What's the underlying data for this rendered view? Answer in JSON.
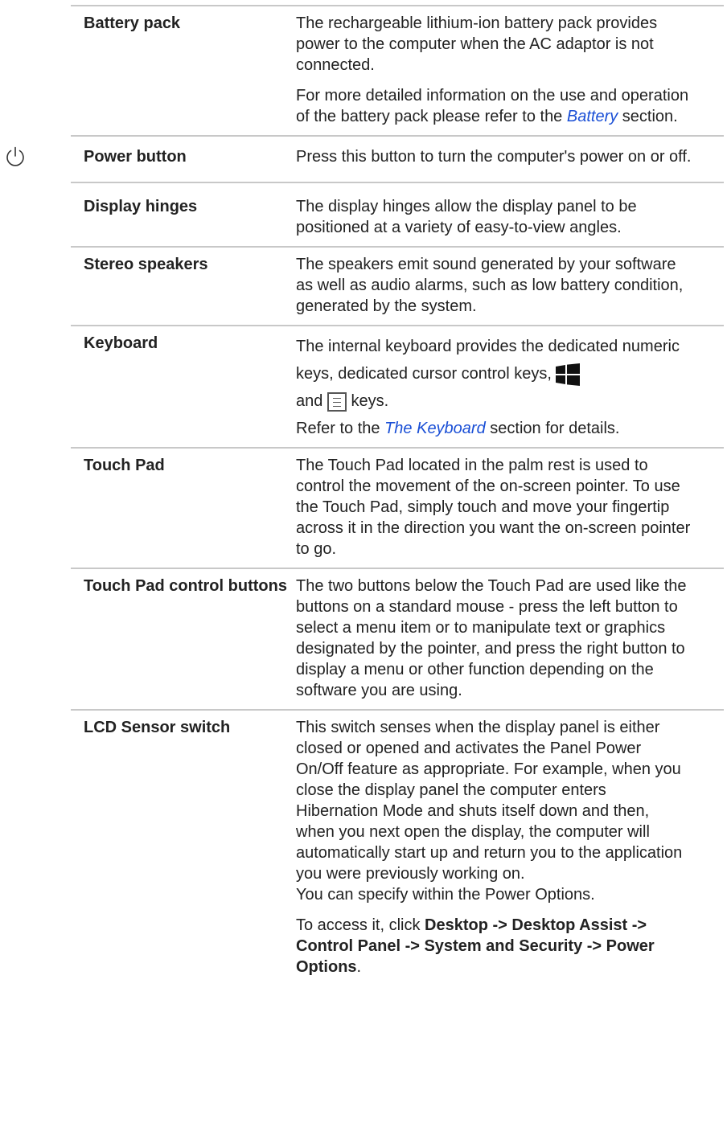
{
  "rows": [
    {
      "term": "Battery pack",
      "paragraphs": [
        "The rechargeable lithium-ion battery pack provides power to the computer when the AC adaptor is not connected.",
        "For more detailed information on the use and operation of the battery pack please refer to the"
      ],
      "link": "Battery",
      "after_link": " section."
    },
    {
      "term": "Power button",
      "text": "Press this button to turn the computer's power on or off.",
      "icon": "power-icon"
    },
    {
      "term": "Display hinges",
      "text": "The display hinges allow the display panel to be positioned at a variety of easy-to-view angles."
    },
    {
      "term": "Stereo speakers",
      "text": "The speakers emit sound generated by your software as well as audio alarms, such as low battery condition, generated by the system."
    },
    {
      "term": "Keyboard",
      "text_before_windows": "The internal keyboard provides the dedicated numeric keys, dedicated cursor control keys,",
      "windows_key_icon": "windows-key-icon",
      "and": "and",
      "menu_key_icon": "application-key-icon",
      "keys": "keys.",
      "refer": "Refer to the",
      "link": "The Keyboard",
      "after_link": " section for details."
    },
    {
      "term": "Touch Pad",
      "text": "The Touch Pad located in the palm rest is used to control the movement of the on-screen pointer. To use the Touch Pad, simply touch and move your fingertip across it in the direction you want the on-screen pointer to go."
    },
    {
      "term": "Touch Pad control buttons",
      "text": "The two buttons below the Touch Pad are used like the buttons on a standard mouse - press the left button to select a menu item or to manipulate text or graphics designated by the pointer, and press the right button to display a menu or other function depending on the software you are using."
    },
    {
      "term": "LCD Sensor switch",
      "text": "This switch senses when the display panel is either closed or opened and activates the Panel Power On/Off feature as appropriate. For example, when you close the display panel the computer enters Hibernation Mode and shuts itself down and then, when you next open the display, the computer will automatically start up and return you to the application you were previously working on.",
      "text2": "You can specify within the Power Options.",
      "access_prefix": "To access it, click ",
      "access_path": "Desktop -> Desktop Assist -> Control Panel -> System and Security -> Power Options",
      "access_suffix": "."
    }
  ],
  "colors": {
    "link": "#1a4fd6",
    "rule": "#c8c8c8"
  }
}
